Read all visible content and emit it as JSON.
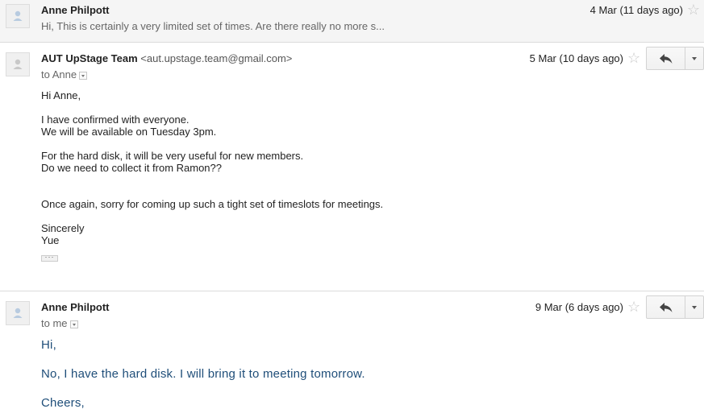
{
  "messages": [
    {
      "sender": "Anne Philpott",
      "date": "4 Mar (11 days ago)",
      "snippet": "Hi, This is certainly a very limited set of times. Are there really no more s..."
    },
    {
      "sender": "AUT UpStage Team",
      "email": "<aut.upstage.team@gmail.com>",
      "date": "5 Mar (10 days ago)",
      "to": "to Anne",
      "body": [
        "Hi Anne,",
        "I have confirmed with everyone.",
        "We will be available on Tuesday 3pm.",
        "For the hard disk, it will be very useful for new members.",
        "Do we need to collect it from Ramon??",
        "Once again, sorry for coming up such a tight set of timeslots for meetings.",
        "Sincerely",
        "Yue"
      ],
      "trimmed": "···"
    },
    {
      "sender": "Anne Philpott",
      "date": "9 Mar (6 days ago)",
      "to": "to me",
      "body": [
        "Hi,",
        "No, I have the hard disk. I will bring it to meeting tomorrow.",
        "Cheers,"
      ]
    }
  ],
  "icons": {
    "star": "☆",
    "avatar": "person-silhouette",
    "reply": "reply-arrow",
    "more": "caret-down"
  },
  "colors": {
    "blue_text": "#1f4e79",
    "star": "#c8c8c8",
    "collapsed_bg": "#f5f5f5"
  }
}
